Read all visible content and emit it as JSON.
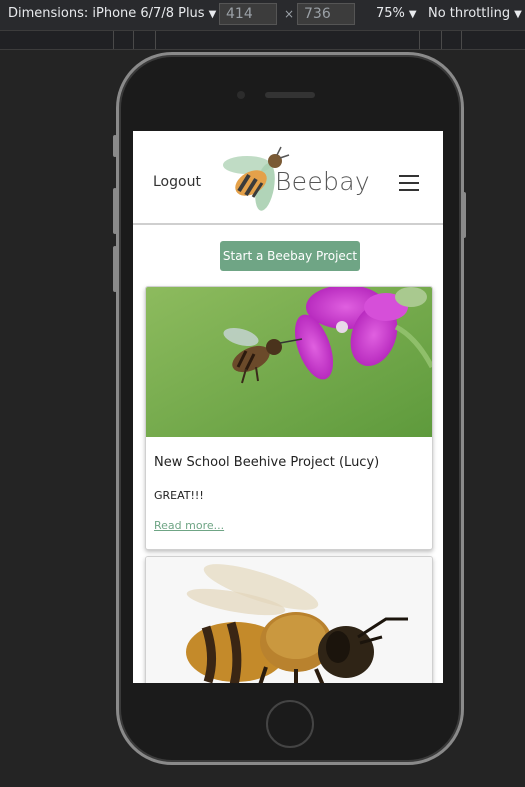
{
  "devtools": {
    "dimensions_label": "Dimensions: iPhone 6/7/8 Plus",
    "width_value": "414",
    "height_value": "736",
    "times": "×",
    "zoom": "75%",
    "throttling": "No throttling",
    "caret": "▼"
  },
  "site": {
    "logout": "Logout",
    "brand": "Beebay",
    "cta": "Start a Beebay Project"
  },
  "cards": [
    {
      "title": "New School Beehive Project (Lucy)",
      "body": "GREAT!!!",
      "link": "Read more..."
    }
  ],
  "colors": {
    "accent": "#6fa585",
    "page_bg": "#242424"
  },
  "icons": [
    "menu-icon",
    "bee-logo-icon",
    "caret-down-icon"
  ]
}
